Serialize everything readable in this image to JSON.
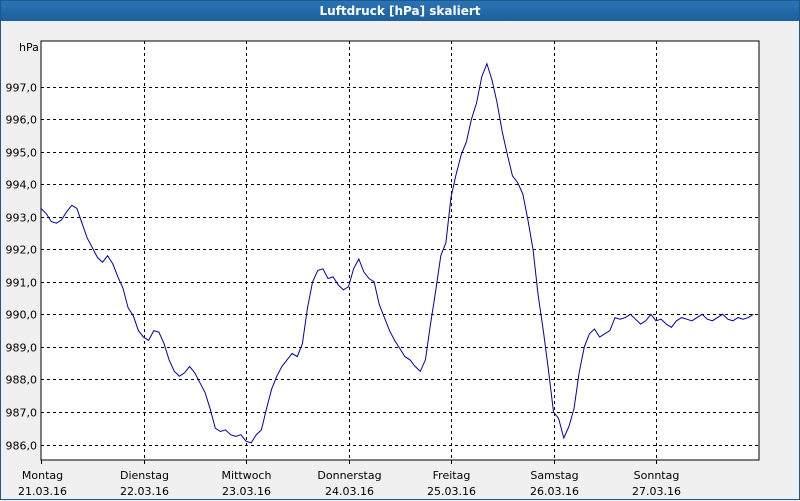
{
  "window": {
    "title": "Luftdruck [hPa] skaliert"
  },
  "chart_data": {
    "type": "line",
    "title": "Luftdruck [hPa] skaliert",
    "ylabel": "hPa",
    "xlabel": "",
    "ylim": [
      985.6,
      998.2
    ],
    "xlim": [
      0,
      6.95
    ],
    "grid": true,
    "yticks": [
      "986,0",
      "987,0",
      "988,0",
      "989,0",
      "990,0",
      "991,0",
      "992,0",
      "993,0",
      "994,0",
      "995,0",
      "996,0",
      "997,0"
    ],
    "xticks": [
      {
        "day": "Montag",
        "date": "21.03.16"
      },
      {
        "day": "Dienstag",
        "date": "22.03.16"
      },
      {
        "day": "Mittwoch",
        "date": "23.03.16"
      },
      {
        "day": "Donnerstag",
        "date": "24.03.16"
      },
      {
        "day": "Freitag",
        "date": "25.03.16"
      },
      {
        "day": "Samstag",
        "date": "26.03.16"
      },
      {
        "day": "Sonntag",
        "date": "27.03.16"
      }
    ],
    "series": [
      {
        "color": "#0000aa",
        "x": [
          0.0,
          0.05,
          0.1,
          0.15,
          0.2,
          0.25,
          0.3,
          0.35,
          0.4,
          0.45,
          0.5,
          0.55,
          0.6,
          0.65,
          0.7,
          0.75,
          0.8,
          0.85,
          0.9,
          0.95,
          1.0,
          1.05,
          1.1,
          1.15,
          1.2,
          1.25,
          1.3,
          1.35,
          1.4,
          1.45,
          1.5,
          1.55,
          1.6,
          1.65,
          1.7,
          1.75,
          1.8,
          1.85,
          1.9,
          1.95,
          2.0,
          2.05,
          2.1,
          2.15,
          2.2,
          2.25,
          2.3,
          2.35,
          2.4,
          2.45,
          2.5,
          2.55,
          2.6,
          2.65,
          2.7,
          2.75,
          2.8,
          2.85,
          2.9,
          2.95,
          3.0,
          3.05,
          3.1,
          3.15,
          3.2,
          3.25,
          3.3,
          3.35,
          3.4,
          3.45,
          3.5,
          3.55,
          3.6,
          3.65,
          3.7,
          3.75,
          3.8,
          3.85,
          3.9,
          3.95,
          4.0,
          4.05,
          4.1,
          4.15,
          4.2,
          4.25,
          4.3,
          4.35,
          4.4,
          4.45,
          4.5,
          4.55,
          4.6,
          4.65,
          4.7,
          4.75,
          4.8,
          4.85,
          4.9,
          4.95,
          5.0,
          5.05,
          5.1,
          5.15,
          5.2,
          5.25,
          5.3,
          5.35,
          5.4,
          5.45,
          5.5,
          5.55,
          5.6,
          5.65,
          5.7,
          5.75,
          5.8,
          5.85,
          5.9,
          5.95,
          6.0,
          6.05,
          6.1,
          6.15,
          6.2,
          6.25,
          6.3,
          6.35,
          6.4,
          6.45,
          6.5,
          6.55,
          6.6,
          6.65,
          6.7,
          6.75,
          6.8,
          6.85,
          6.9,
          6.95
        ],
        "y": [
          993.25,
          993.1,
          992.85,
          992.8,
          992.9,
          993.15,
          993.35,
          993.25,
          992.8,
          992.35,
          992.05,
          991.75,
          991.6,
          991.8,
          991.55,
          991.15,
          990.8,
          990.2,
          989.95,
          989.5,
          989.3,
          989.2,
          989.5,
          989.45,
          989.1,
          988.6,
          988.25,
          988.1,
          988.2,
          988.4,
          988.2,
          987.9,
          987.6,
          987.1,
          986.5,
          986.4,
          986.45,
          986.3,
          986.25,
          986.3,
          986.1,
          986.05,
          986.3,
          986.45,
          987.1,
          987.7,
          988.1,
          988.4,
          988.6,
          988.8,
          988.7,
          989.1,
          990.2,
          991.0,
          991.35,
          991.4,
          991.1,
          991.15,
          990.9,
          990.75,
          990.85,
          991.4,
          991.7,
          991.3,
          991.1,
          991.0,
          990.3,
          989.9,
          989.5,
          989.2,
          988.95,
          988.7,
          988.6,
          988.4,
          988.25,
          988.6,
          989.7,
          990.7,
          991.8,
          992.2,
          993.6,
          994.3,
          994.9,
          995.3,
          996.0,
          996.5,
          997.3,
          997.7,
          997.2,
          996.5,
          995.6,
          994.9,
          994.25,
          994.05,
          993.7,
          992.9,
          992.0,
          990.6,
          989.5,
          988.3,
          987.0,
          986.8,
          986.2,
          986.55,
          987.1,
          988.2,
          989.0,
          989.4,
          989.55,
          989.3,
          989.4,
          989.5,
          989.9,
          989.85,
          989.9,
          990.0,
          989.85,
          989.7,
          989.8,
          990.0,
          989.8,
          989.85,
          989.7,
          989.6,
          989.8,
          989.9,
          989.85,
          989.8,
          989.9,
          990.0,
          989.85,
          989.8,
          989.9,
          990.0,
          989.85,
          989.8,
          989.9,
          989.85,
          989.9,
          990.0
        ]
      }
    ]
  }
}
